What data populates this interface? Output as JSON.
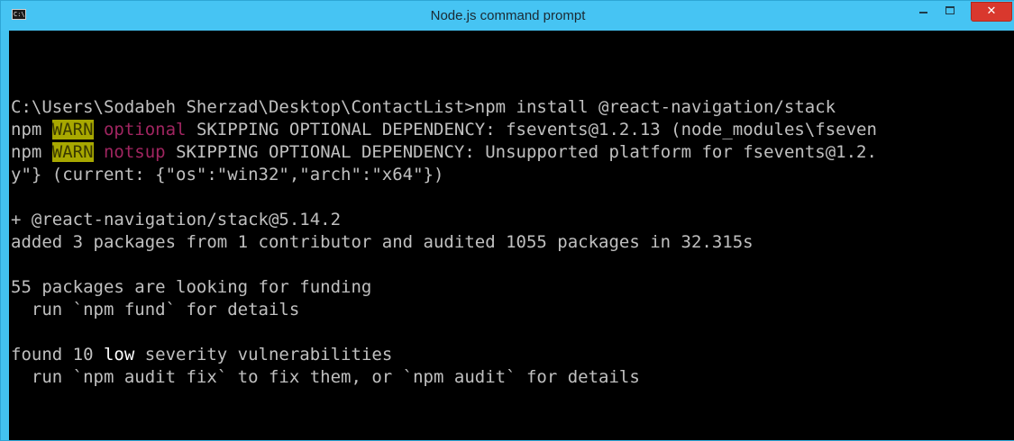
{
  "window": {
    "title": "Node.js command prompt",
    "icon_label": "C:\\",
    "controls": {
      "minimize": "–",
      "maximize": "□",
      "close": "✕"
    }
  },
  "terminal": {
    "cmd_line": "C:\\Users\\Sodabeh Sherzad\\Desktop\\ContactList>npm install @react-navigation/stack",
    "warn1": {
      "prefix": "npm ",
      "badge": "WARN",
      "tag": "optional",
      "text": " SKIPPING OPTIONAL DEPENDENCY: fsevents@1.2.13 (node_modules\\fseven"
    },
    "warn2": {
      "prefix": "npm ",
      "badge": "WARN",
      "tag": "notsup",
      "text": " SKIPPING OPTIONAL DEPENDENCY: Unsupported platform for fsevents@1.2."
    },
    "warn2_cont": "y\"} (current: {\"os\":\"win32\",\"arch\":\"x64\"})",
    "added_pkg": "+ @react-navigation/stack@5.14.2",
    "added_summary": "added 3 packages from 1 contributor and audited 1055 packages in 32.315s",
    "funding_line": "55 packages are looking for funding",
    "fund_hint": "  run `npm fund` for details",
    "vuln": {
      "pre": "found 10 ",
      "word": "low",
      "post": " severity vulnerabilities"
    },
    "audit_hint": "  run `npm audit fix` to fix them, or `npm audit` for details"
  },
  "colors": {
    "titlebar": "#46c4f3",
    "console_bg": "#000000",
    "console_text": "#c0c0c0",
    "warn_badge_bg": "#a8a800",
    "warn_tag": "#a02560",
    "close_button": "#d9382d"
  }
}
